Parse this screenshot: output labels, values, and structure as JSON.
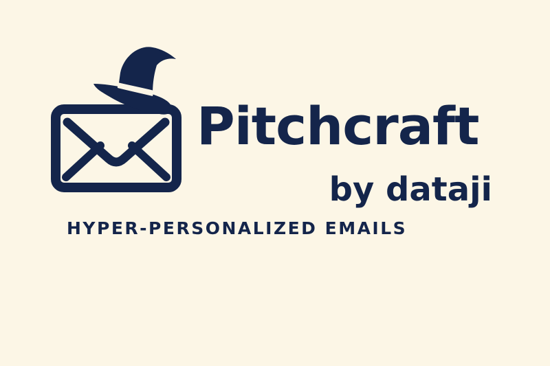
{
  "colors": {
    "background": "#fcf6e6",
    "ink": "#14254b"
  },
  "logo": {
    "icons": [
      "envelope-icon",
      "wizard-hat-icon"
    ]
  },
  "brand": {
    "name": "Pitchcraft",
    "byline": "by dataji",
    "tagline": "HYPER-PERSONALIZED EMAILS"
  }
}
